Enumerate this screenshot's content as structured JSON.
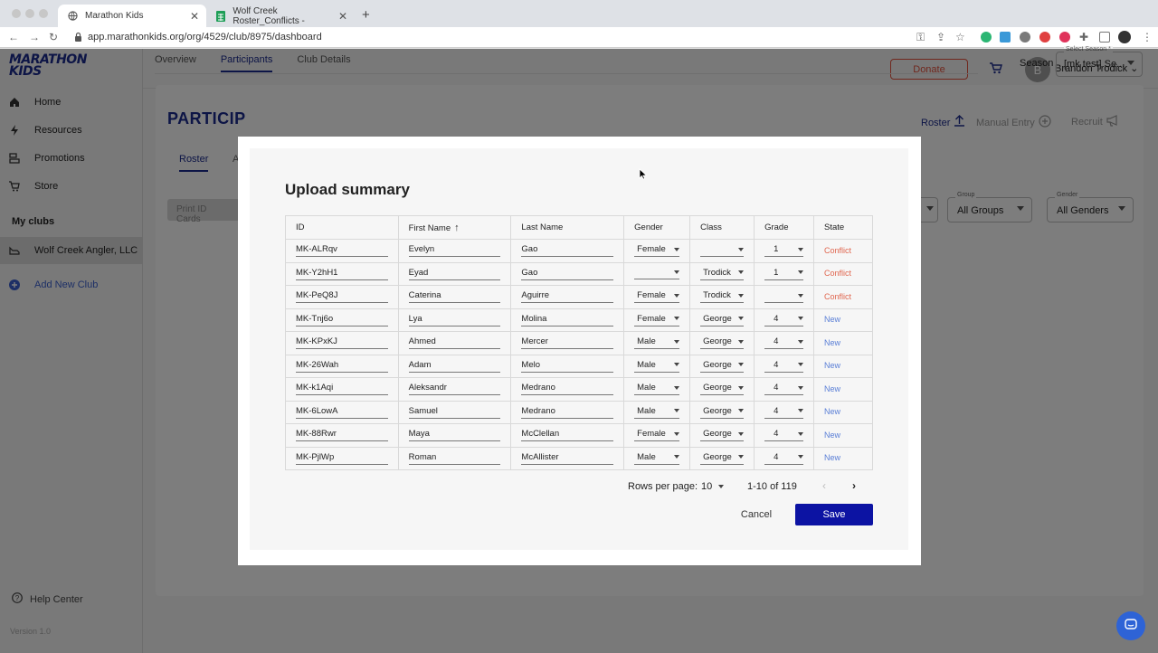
{
  "browser": {
    "tabs": [
      {
        "title": "Marathon Kids",
        "active": true
      },
      {
        "title": "Wolf Creek Roster_Conflicts -",
        "active": false
      }
    ],
    "url": "app.marathonkids.org/org/4529/club/8975/dashboard"
  },
  "app": {
    "logo_line1": "MARATHON",
    "logo_line2": "KIDS",
    "sidebar": {
      "items": [
        {
          "label": "Home",
          "icon": "home-icon"
        },
        {
          "label": "Resources",
          "icon": "bolt-icon"
        },
        {
          "label": "Promotions",
          "icon": "promotions-icon"
        },
        {
          "label": "Store",
          "icon": "cart-icon"
        }
      ],
      "my_clubs_heading": "My clubs",
      "club": "Wolf Creek Angler, LLC",
      "add_club": "Add New Club",
      "help": "Help Center",
      "version": "Version 1.0"
    },
    "header": {
      "donate": "Donate",
      "avatar_initial": "B",
      "user_name": "Brandon Trodick"
    },
    "page_tabs": [
      "Overview",
      "Participants",
      "Club Details"
    ],
    "season": {
      "label": "Season",
      "caption": "Select Season *",
      "value": "[mk test] Se..."
    },
    "participants_title": "PARTICIP",
    "roster_tab": "Roster",
    "second_tab_fragment": "A",
    "print_button": "Print ID Cards",
    "actions": {
      "roster": "Roster",
      "manual_entry": "Manual Entry",
      "recruit": "Recruit"
    },
    "filters": {
      "group_caption": "Group",
      "group_value": "All Groups",
      "gender_caption": "Gender",
      "gender_value": "All Genders"
    }
  },
  "modal": {
    "title": "Upload summary",
    "columns": [
      "ID",
      "First Name",
      "Last Name",
      "Gender",
      "Class",
      "Grade",
      "State"
    ],
    "rows": [
      {
        "id": "MK-ALRqv",
        "first": "Evelyn",
        "last": "Gao",
        "gender": "Female",
        "class": "",
        "grade": "1",
        "state": "Conflict"
      },
      {
        "id": "MK-Y2hH1",
        "first": "Eyad",
        "last": "Gao",
        "gender": "",
        "class": "Trodick",
        "grade": "1",
        "state": "Conflict"
      },
      {
        "id": "MK-PeQ8J",
        "first": "Caterina",
        "last": "Aguirre",
        "gender": "Female",
        "class": "Trodick",
        "grade": "",
        "state": "Conflict"
      },
      {
        "id": "MK-Tnj6o",
        "first": "Lya",
        "last": "Molina",
        "gender": "Female",
        "class": "George",
        "grade": "4",
        "state": "New"
      },
      {
        "id": "MK-KPxKJ",
        "first": "Ahmed",
        "last": "Mercer",
        "gender": "Male",
        "class": "George",
        "grade": "4",
        "state": "New"
      },
      {
        "id": "MK-26Wah",
        "first": "Adam",
        "last": "Melo",
        "gender": "Male",
        "class": "George",
        "grade": "4",
        "state": "New"
      },
      {
        "id": "MK-k1Aqi",
        "first": "Aleksandr",
        "last": "Medrano",
        "gender": "Male",
        "class": "George",
        "grade": "4",
        "state": "New"
      },
      {
        "id": "MK-6LowA",
        "first": "Samuel",
        "last": "Medrano",
        "gender": "Male",
        "class": "George",
        "grade": "4",
        "state": "New"
      },
      {
        "id": "MK-88Rwr",
        "first": "Maya",
        "last": "McClellan",
        "gender": "Female",
        "class": "George",
        "grade": "4",
        "state": "New"
      },
      {
        "id": "MK-PjlWp",
        "first": "Roman",
        "last": "McAllister",
        "gender": "Male",
        "class": "George",
        "grade": "4",
        "state": "New"
      }
    ],
    "pagination": {
      "rows_per_page_label": "Rows per page:",
      "rows_per_page": "10",
      "range": "1-10 of 119"
    },
    "cancel": "Cancel",
    "save": "Save"
  },
  "colors": {
    "brand": "#1a2a8c",
    "save": "#0c13a3",
    "conflict": "#e0664f",
    "new": "#5a7fd6",
    "donate": "#e0503c"
  }
}
